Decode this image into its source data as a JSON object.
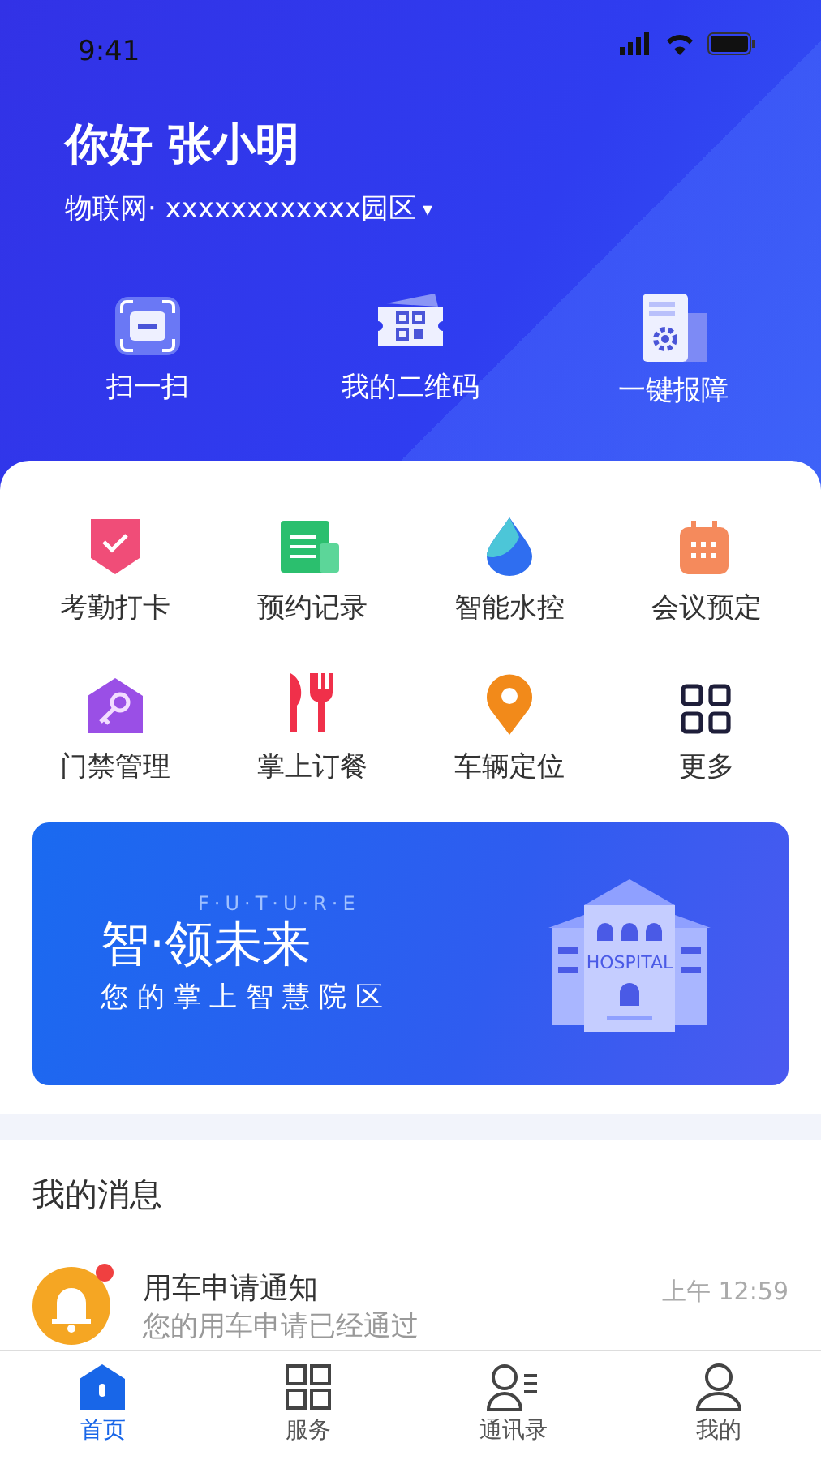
{
  "status_bar": {
    "time": "9:41"
  },
  "header": {
    "greeting": "你好 张小明",
    "location": "物联网· xxxxxxxxxxxx园区",
    "caret": "▾"
  },
  "quick_actions": [
    {
      "kind": "scan",
      "label": "扫一扫"
    },
    {
      "kind": "qr",
      "label": "我的二维码"
    },
    {
      "kind": "repair",
      "label": "一键报障"
    }
  ],
  "services": [
    {
      "kind": "attendance",
      "label": "考勤打卡"
    },
    {
      "kind": "booking",
      "label": "预约记录"
    },
    {
      "kind": "water",
      "label": "智能水控"
    },
    {
      "kind": "meeting",
      "label": "会议预定"
    },
    {
      "kind": "access",
      "label": "门禁管理"
    },
    {
      "kind": "dining",
      "label": "掌上订餐"
    },
    {
      "kind": "location",
      "label": "车辆定位"
    },
    {
      "kind": "more",
      "label": "更多"
    }
  ],
  "banner": {
    "tagline": "F·U·T·U·R·E",
    "title": "智·领未来",
    "subtitle": "您 的 掌 上 智 慧 院 区",
    "sign": "HOSPITAL"
  },
  "messages": {
    "title": "我的消息",
    "items": [
      {
        "title": "用车申请通知",
        "time": "上午 12:59",
        "preview": "您的用车申请已经通过",
        "unread": true
      }
    ]
  },
  "bottom_nav": [
    {
      "kind": "home",
      "label": "首页",
      "selected": true
    },
    {
      "kind": "services",
      "label": "服务",
      "selected": false
    },
    {
      "kind": "contacts",
      "label": "通讯录",
      "selected": false
    },
    {
      "kind": "profile",
      "label": "我的",
      "selected": false
    }
  ]
}
